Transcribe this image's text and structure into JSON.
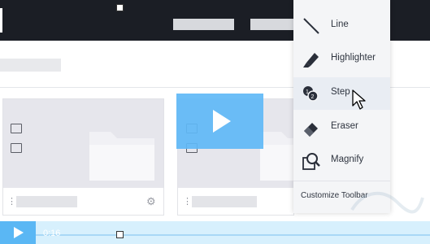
{
  "menu": {
    "items": [
      {
        "label": "Line",
        "icon": "line-icon"
      },
      {
        "label": "Highlighter",
        "icon": "highlighter-icon"
      },
      {
        "label": "Step",
        "icon": "step-icon"
      },
      {
        "label": "Eraser",
        "icon": "eraser-icon"
      },
      {
        "label": "Magnify",
        "icon": "magnify-icon"
      }
    ],
    "customize_label": "Customize Toolbar"
  },
  "video": {
    "time": "0:16"
  },
  "colors": {
    "accent": "#5ab7f4",
    "topbar": "#1b1e25",
    "menu_bg": "#f4f5f7"
  }
}
